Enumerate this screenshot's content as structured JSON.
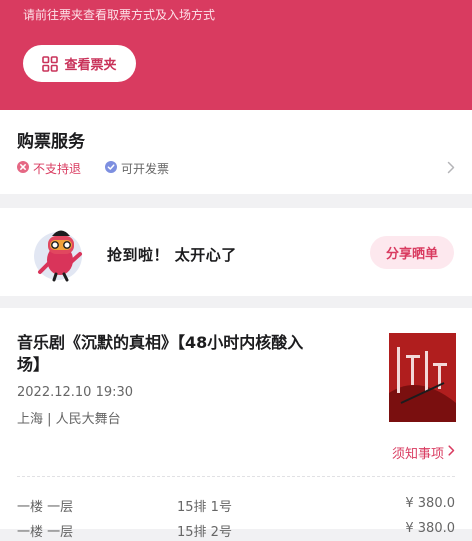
{
  "banner": {
    "hint": "请前往票夹查看取票方式及入场方式",
    "wallet_button_label": "查看票夹",
    "color": "#d93b60"
  },
  "service": {
    "title": "购票服务",
    "tags": [
      {
        "label": "不支持退",
        "icon": "x-circle-icon"
      },
      {
        "label": "可开发票",
        "icon": "check-circle-icon"
      }
    ]
  },
  "share": {
    "text": "抢到啦！ 太开心了",
    "button_label": "分享晒单"
  },
  "order": {
    "title": "音乐剧《沉默的真相》【48小时内核酸入场】",
    "datetime": "2022.12.10 19:30",
    "venue": "上海 | 人民大舞台",
    "notice_label": "须知事项",
    "tickets": [
      {
        "area": "一楼 一层",
        "seat": "15排 1号",
        "price": "¥ 380.0"
      },
      {
        "area": "一楼 一层",
        "seat": "15排 2号",
        "price": "¥ 380.0"
      }
    ]
  }
}
